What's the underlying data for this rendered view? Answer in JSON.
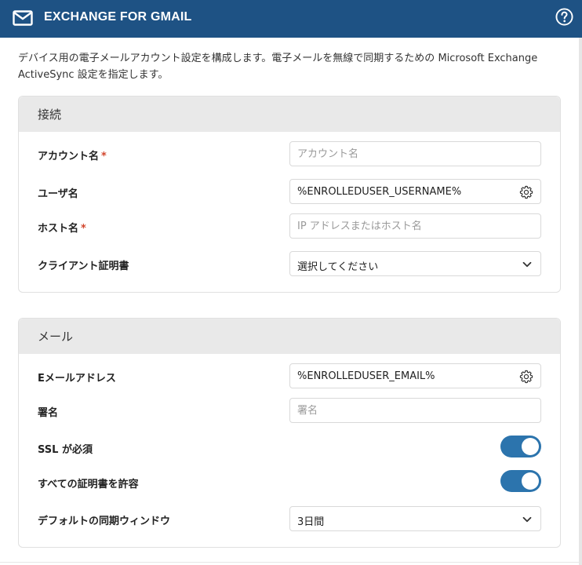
{
  "header": {
    "title": "EXCHANGE FOR GMAIL",
    "icon": "mail-icon",
    "help_icon": "help-icon",
    "bg_color": "#1e5284"
  },
  "description": "デバイス用の電子メールアカウント設定を構成します。電子メールを無線で同期するための Microsoft Exchange ActiveSync 設定を指定します。",
  "connection": {
    "title": "接続",
    "account_name": {
      "label": "アカウント名",
      "required_mark": "*",
      "value": "",
      "placeholder": "アカウント名"
    },
    "user_name": {
      "label": "ユーザ名",
      "value": "%ENROLLEDUSER_USERNAME%"
    },
    "host_name": {
      "label": "ホスト名",
      "required_mark": "*",
      "value": "",
      "placeholder": "IP アドレスまたはホスト名"
    },
    "client_cert": {
      "label": "クライアント証明書",
      "selected": "選択してください"
    }
  },
  "mail": {
    "title": "メール",
    "email_address": {
      "label": "Eメールアドレス",
      "value": "%ENROLLEDUSER_EMAIL%"
    },
    "signature": {
      "label": "署名",
      "value": "",
      "placeholder": "署名"
    },
    "ssl_required": {
      "label": "SSL が必須",
      "on": true
    },
    "allow_all_certs": {
      "label": "すべての証明書を許容",
      "on": true
    },
    "sync_window": {
      "label": "デフォルトの同期ウィンドウ",
      "selected": "3日間"
    }
  },
  "colors": {
    "toggle_on": "#2c74ad",
    "required": "#d2452c"
  }
}
